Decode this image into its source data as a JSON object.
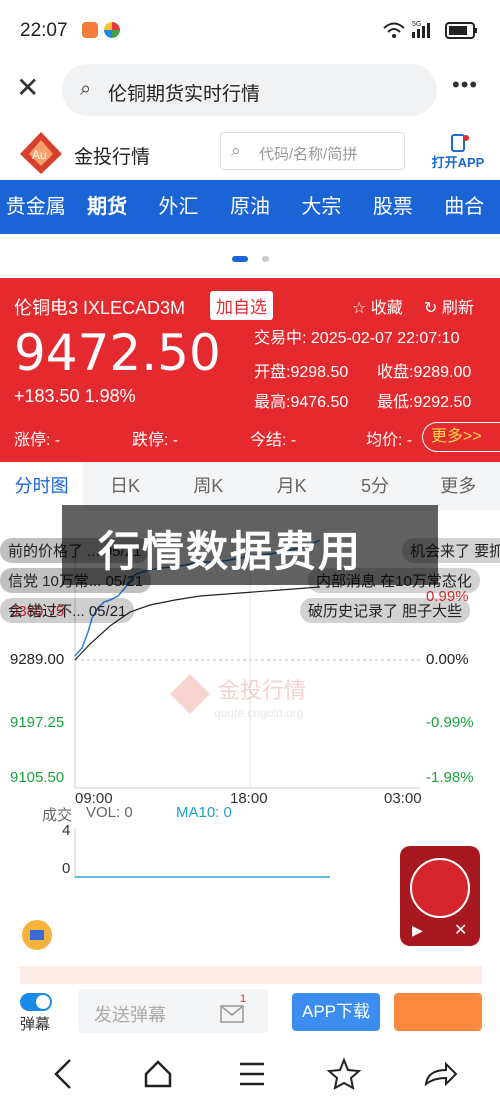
{
  "status": {
    "time": "22:07"
  },
  "browser": {
    "query": "伦铜期货实时行情"
  },
  "site": {
    "brand": "金投行情",
    "logo_text": "Au",
    "search_placeholder": "代码/名称/简拼",
    "open_app": "打开APP"
  },
  "categories": [
    "贵金属",
    "期货",
    "外汇",
    "原油",
    "大宗",
    "股票",
    "曲合"
  ],
  "quote": {
    "name": "伦铜电3 IXLECAD3M",
    "add_label": "加自选",
    "fav_label": "☆ 收藏",
    "refresh_label": "↻ 刷新",
    "price": "9472.50",
    "change": "+183.50 1.98%",
    "trade_time": "交易中: 2025-02-07 22:07:10",
    "open": "开盘:9298.50",
    "prev_close": "收盘:9289.00",
    "high": "最高:9476.50",
    "low": "最低:9292.50",
    "limit_up": "涨停: -",
    "limit_down": "跌停: -",
    "settle": "今结: -",
    "avg": "均价: -",
    "more": "更多>>"
  },
  "chart_tabs": [
    "分时图",
    "日K",
    "周K",
    "月K",
    "5分",
    "更多"
  ],
  "chart": {
    "watermark": "金投行情",
    "watermark_sub": "quote.cngold.org",
    "y_left": [
      "9380.75",
      "9289.00",
      "9197.25",
      "9105.50"
    ],
    "y_right": [
      "0.99%",
      "0.00%",
      "-0.99%",
      "-1.98%"
    ],
    "times": [
      "09:00",
      "18:00",
      "03:00"
    ],
    "vol_label": "成交",
    "vol": "VOL: 0",
    "ma10": "MA10: 0",
    "vol_ticks": [
      "4",
      "0"
    ]
  },
  "danmaku": [
    "前的价格了 ... 05/21",
    "信党 10万常... 05/21",
    "会 错过不... 05/21",
    "机会来了 要抓",
    "内部消息 在10万常态化",
    "破历史记录了 胆子大些"
  ],
  "overlay_text": "行情数据费用",
  "bottom": {
    "danmaku_label": "弹幕",
    "send_placeholder": "发送弹幕",
    "badge": "1",
    "app_download": "APP下载"
  },
  "colors": {
    "accent": "#1a64d6",
    "up": "#e52a2f",
    "down": "#1aa33c"
  }
}
